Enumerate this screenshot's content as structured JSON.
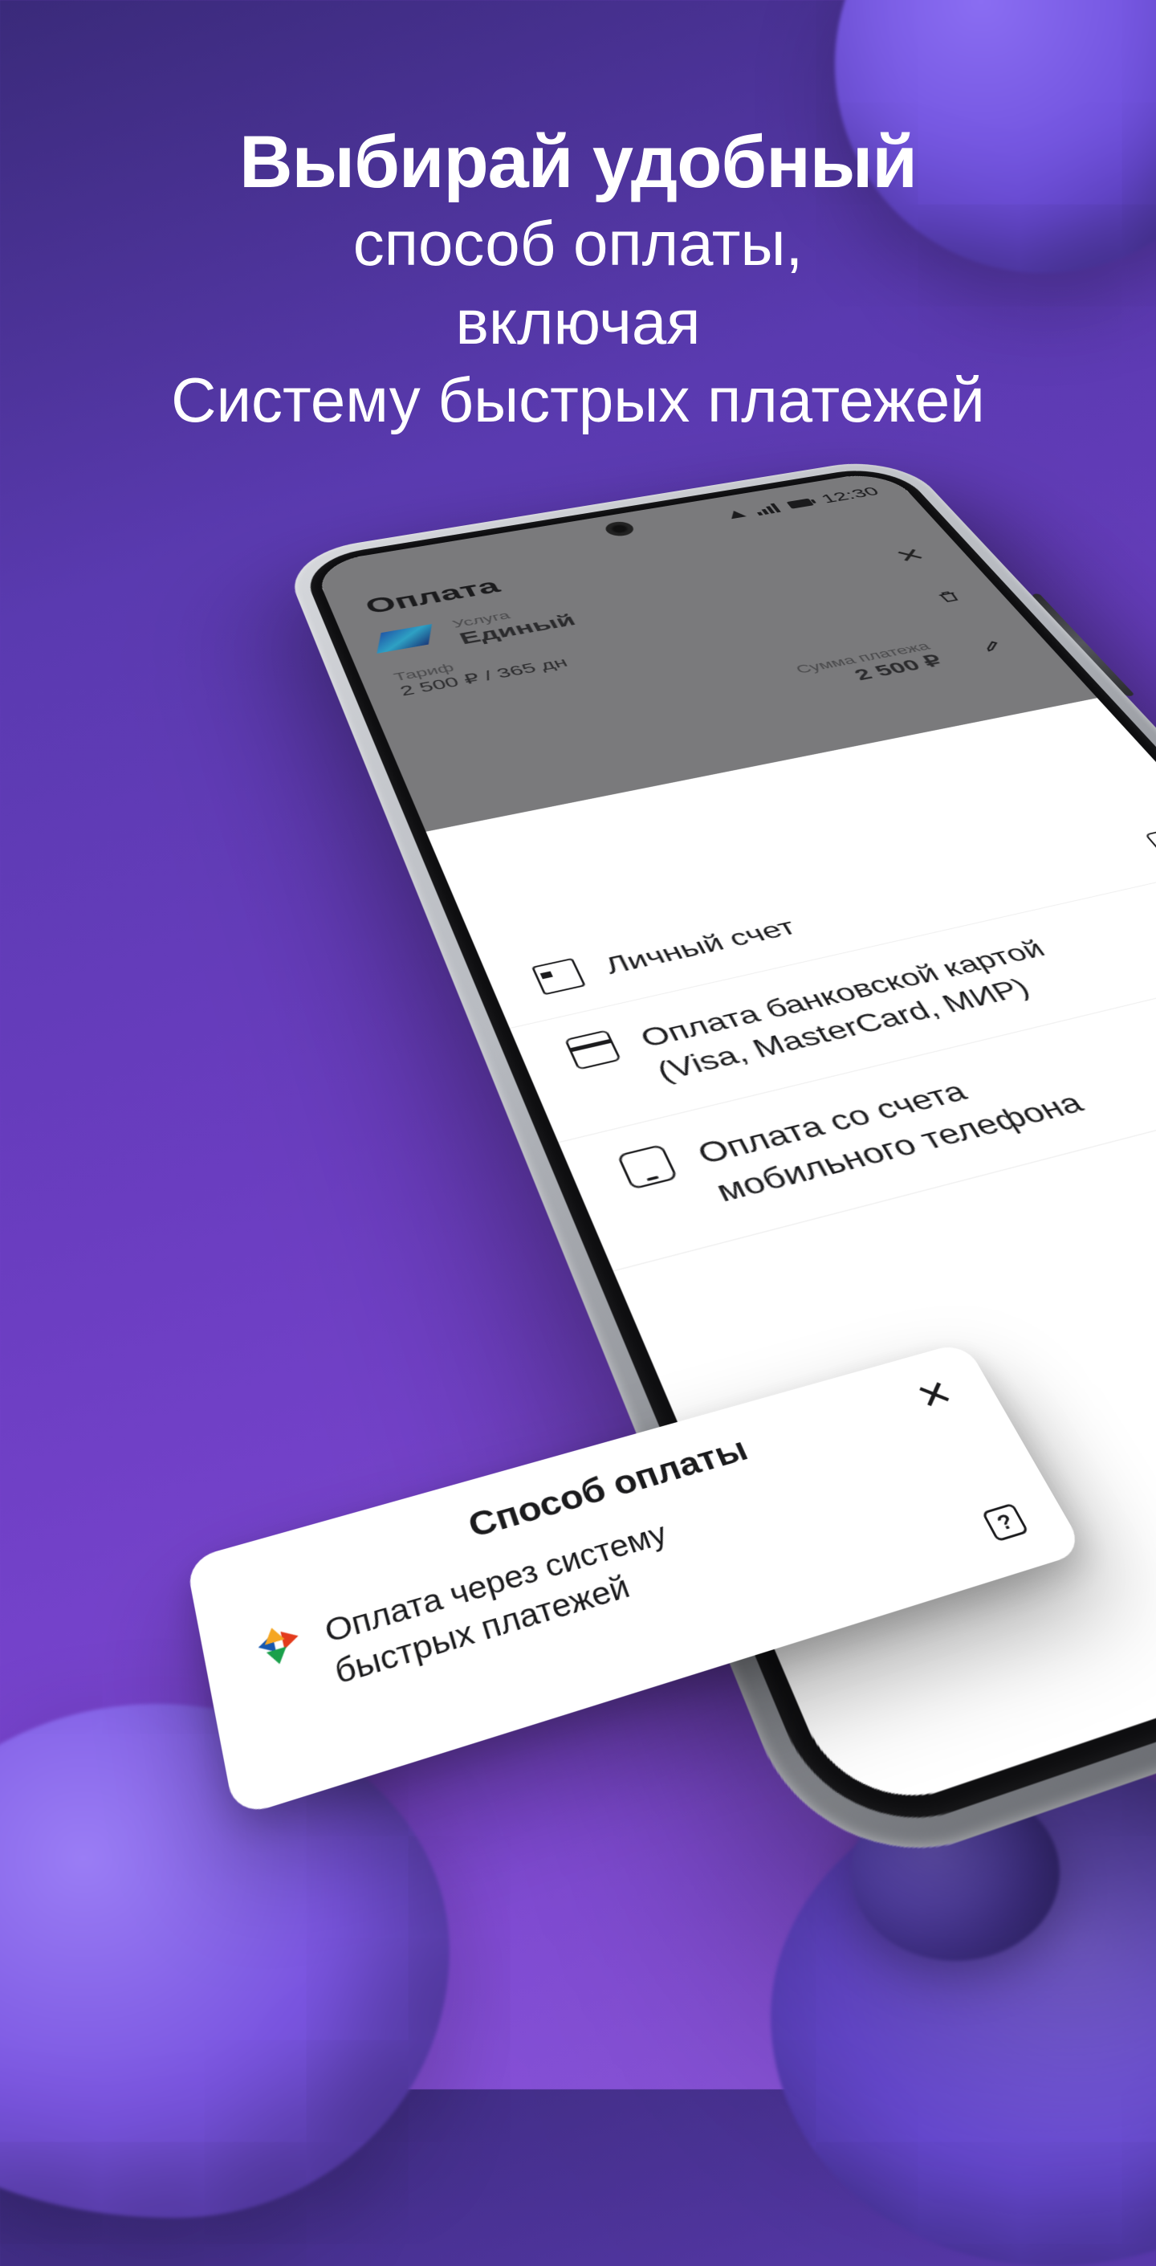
{
  "headline": {
    "bold": "Выбирай удобный",
    "line2": "способ оплаты,",
    "line3": "включая",
    "line4": "Систему быстрых платежей"
  },
  "statusbar": {
    "time": "12:30"
  },
  "page": {
    "title": "Оплата",
    "service_label": "Услуга",
    "service_name": "Единый",
    "tariff_label": "Тариф",
    "tariff_value": "2 500 ₽ / 365 дн",
    "sum_label": "Сумма платежа",
    "sum_value": "2 500 ₽"
  },
  "modal": {
    "title": "Способ оплаты",
    "close": "✕",
    "help": "?",
    "options": [
      {
        "id": "sbp",
        "text_line1": "Оплата через систему",
        "text_line2": "быстрых платежей"
      },
      {
        "id": "wallet",
        "text_line1": "Личный счет",
        "text_line2": ""
      },
      {
        "id": "card",
        "text_line1": "Оплата банковской картой",
        "text_line2": "(Visa, MasterCard, МИР)"
      },
      {
        "id": "phone",
        "text_line1": "Оплата со счета",
        "text_line2": "мобильного телефона"
      }
    ]
  }
}
